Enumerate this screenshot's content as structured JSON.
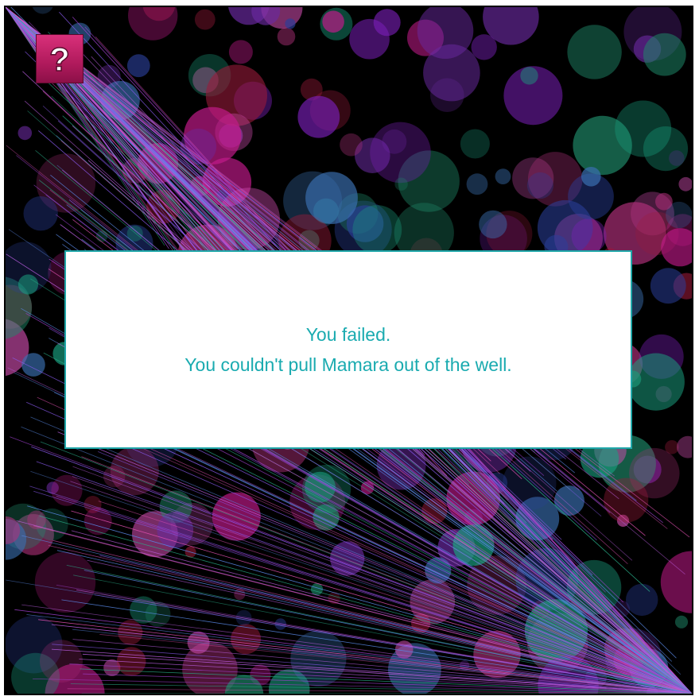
{
  "help": {
    "icon": "question-mark-icon",
    "label": "?"
  },
  "dialog": {
    "line1": "You failed.",
    "line2": "You couldn't pull Mamara out of the well."
  },
  "colors": {
    "dialog_text": "#1aabb0",
    "dialog_border": "#1fa6a8",
    "help_button": "#c2246a",
    "background": "#000000"
  }
}
